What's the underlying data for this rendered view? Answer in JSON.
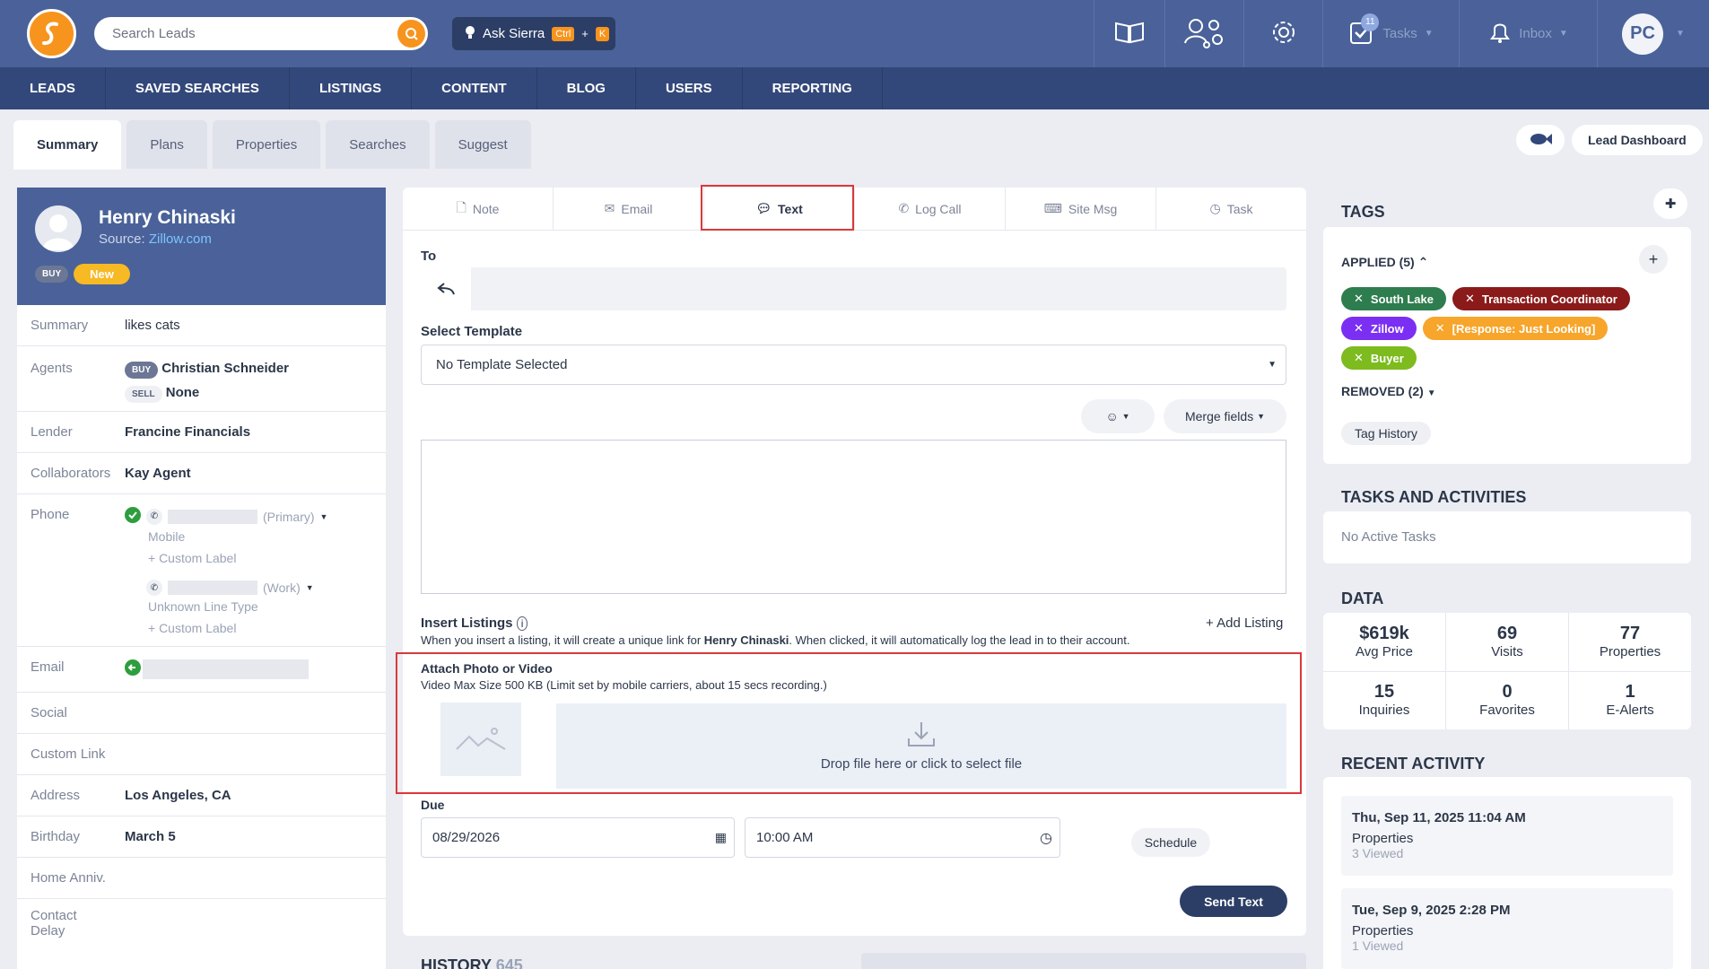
{
  "search": {
    "placeholder": "Search Leads"
  },
  "ask": {
    "label": "Ask Sierra",
    "kbd1": "Ctrl",
    "plus": "+",
    "kbd2": "K"
  },
  "top": {
    "tasks_label": "Tasks",
    "tasks_count": "11",
    "inbox_label": "Inbox",
    "avatar_initials": "PC"
  },
  "nav": [
    "LEADS",
    "SAVED SEARCHES",
    "LISTINGS",
    "CONTENT",
    "BLOG",
    "USERS",
    "REPORTING"
  ],
  "subtabs": [
    "Summary",
    "Plans",
    "Properties",
    "Searches",
    "Suggest"
  ],
  "dash": {
    "label": "Lead Dashboard"
  },
  "lead": {
    "name": "Henry Chinaski",
    "source_label": "Source: ",
    "source": "Zillow.com",
    "badge_buy": "BUY",
    "badge_new": "New"
  },
  "rows": {
    "summary_k": "Summary",
    "summary_v": "likes cats",
    "agents_k": "Agents",
    "buy": "BUY",
    "buy_agent": "Christian Schneider",
    "sell": "SELL",
    "sell_agent": "None",
    "lender_k": "Lender",
    "lender_v": "Francine Financials",
    "collab_k": "Collaborators",
    "collab_v": "Kay Agent",
    "phone_k": "Phone",
    "phone1_type": "(Primary)",
    "phone1_label": "Mobile",
    "custom1": "+ Custom Label",
    "phone2_type": "(Work)",
    "phone2_label": "Unknown Line Type",
    "custom2": "+ Custom Label",
    "email_k": "Email",
    "social_k": "Social",
    "custom_link_k": "Custom Link",
    "address_k": "Address",
    "address_v": "Los Angeles, CA",
    "birthday_k": "Birthday",
    "birthday_v": "March 5",
    "anniv_k": "Home Anniv.",
    "contact_k1": "Contact",
    "contact_k2": "Delay"
  },
  "ctabs": [
    "Note",
    "Email",
    "Text",
    "Log Call",
    "Site Msg",
    "Task"
  ],
  "compose": {
    "to": "To",
    "template_label": "Select Template",
    "template_value": "No Template Selected",
    "merge": "Merge fields",
    "insert_title": "Insert Listings",
    "add_listing": "+ Add Listing",
    "insert_desc_1": "When you insert a listing, it will create a unique link for ",
    "insert_desc_name": "Henry Chinaski",
    "insert_desc_2": ". When clicked, it will automatically log the lead in to their account.",
    "attach_title": "Attach Photo or Video",
    "attach_desc": "Video Max Size 500 KB (Limit set by mobile carriers, about 15 secs recording.)",
    "drop": "Drop file here or click to select file",
    "due": "Due",
    "date": "08/29/2026",
    "time": "10:00 AM",
    "schedule": "Schedule",
    "send": "Send Text",
    "history": "HISTORY",
    "history_count": "645"
  },
  "tags": {
    "title": "TAGS",
    "applied": "APPLIED (5)",
    "removed": "REMOVED (2)",
    "history": "Tag History",
    "items": [
      {
        "label": "South Lake",
        "color": "#2e7d4f"
      },
      {
        "label": "Transaction Coordinator",
        "color": "#8b1a1a"
      },
      {
        "label": "Zillow",
        "color": "#7b2ff2"
      },
      {
        "label": "[Response: Just Looking]",
        "color": "#f7a52b"
      },
      {
        "label": "Buyer",
        "color": "#7dbb1f"
      }
    ]
  },
  "tasks": {
    "title": "TASKS AND ACTIVITIES",
    "empty": "No Active Tasks"
  },
  "data": {
    "title": "DATA",
    "cells": [
      {
        "n": "$619k",
        "t": "Avg Price"
      },
      {
        "n": "69",
        "t": "Visits"
      },
      {
        "n": "77",
        "t": "Properties"
      },
      {
        "n": "15",
        "t": "Inquiries"
      },
      {
        "n": "0",
        "t": "Favorites"
      },
      {
        "n": "1",
        "t": "E-Alerts"
      }
    ]
  },
  "recent": {
    "title": "RECENT ACTIVITY",
    "items": [
      {
        "date": "Thu, Sep 11, 2025 11:04 AM",
        "type": "Properties",
        "detail": "3 Viewed"
      },
      {
        "date": "Tue, Sep 9, 2025 2:28 PM",
        "type": "Properties",
        "detail": "1 Viewed"
      }
    ]
  }
}
